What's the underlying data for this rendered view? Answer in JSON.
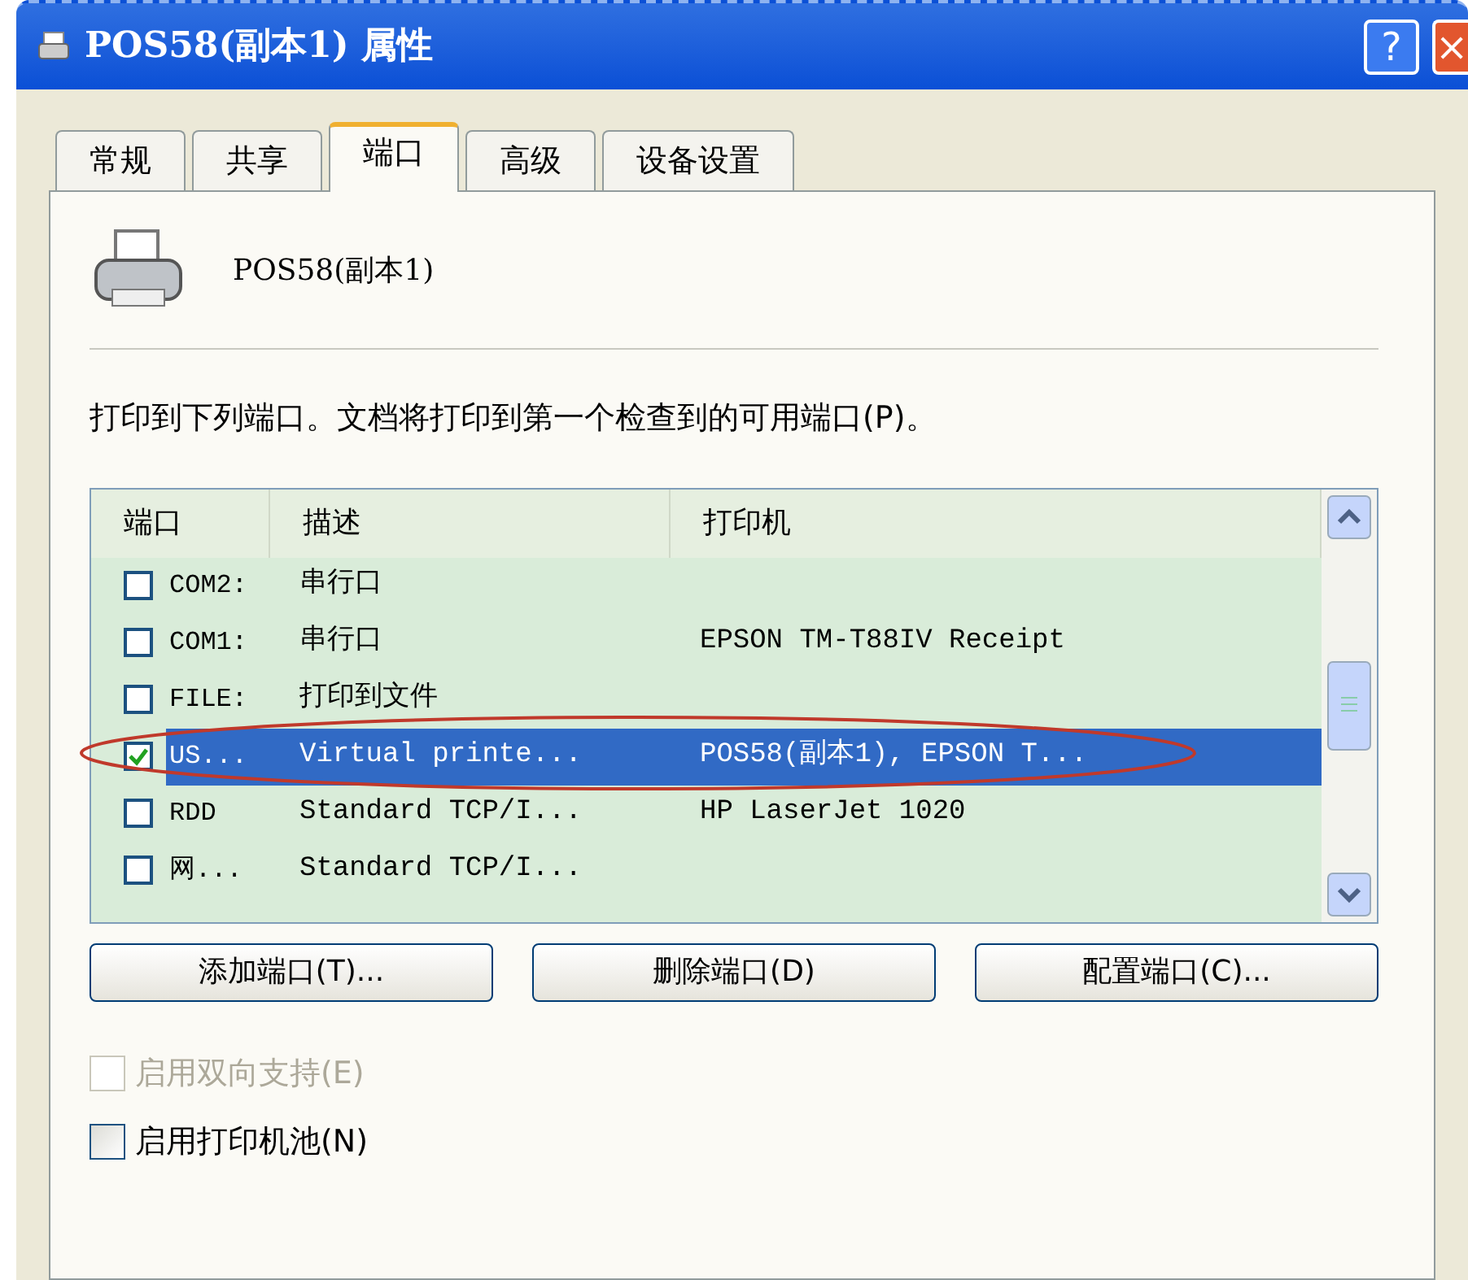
{
  "window": {
    "title": "POS58(副本1) 属性",
    "help_button": "?",
    "close_button": "×"
  },
  "tabs": [
    {
      "label": "常规",
      "selected": false
    },
    {
      "label": "共享",
      "selected": false
    },
    {
      "label": "端口",
      "selected": true
    },
    {
      "label": "高级",
      "selected": false
    },
    {
      "label": "设备设置",
      "selected": false
    }
  ],
  "printer_name": "POS58(副本1)",
  "instruction": "打印到下列端口。文档将打印到第一个检查到的可用端口(P)。",
  "port_list": {
    "columns": [
      "端口",
      "描述",
      "打印机"
    ],
    "rows": [
      {
        "port": "COM2:",
        "description": "串行口",
        "printer": "",
        "checked": false,
        "selected": false
      },
      {
        "port": "COM1:",
        "description": "串行口",
        "printer": "EPSON TM-T88IV Receipt",
        "checked": false,
        "selected": false
      },
      {
        "port": "FILE:",
        "description": "打印到文件",
        "printer": "",
        "checked": false,
        "selected": false
      },
      {
        "port": "US...",
        "description": "Virtual printe...",
        "printer": "POS58(副本1), EPSON T...",
        "checked": true,
        "selected": true
      },
      {
        "port": "RDD",
        "description": "Standard TCP/I...",
        "printer": "HP LaserJet 1020",
        "checked": false,
        "selected": false
      },
      {
        "port": "网...",
        "description": "Standard TCP/I...",
        "printer": "",
        "checked": false,
        "selected": false
      }
    ]
  },
  "buttons": [
    "添加端口(T)...",
    "删除端口(D)",
    "配置端口(C)..."
  ],
  "options": [
    {
      "label": "启用双向支持(E)",
      "checked": false,
      "disabled": true
    },
    {
      "label": "启用打印机池(N)",
      "checked": false,
      "disabled": false
    }
  ]
}
